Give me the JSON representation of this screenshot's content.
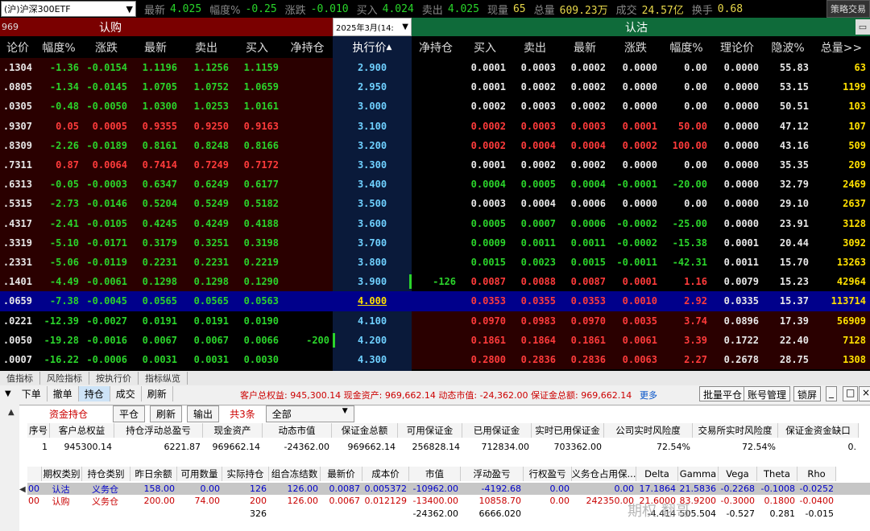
{
  "quote": {
    "symbol": "(沪)沪深300ETF",
    "items": [
      {
        "label": "最新",
        "value": "4.025",
        "cls": "qg"
      },
      {
        "label": "幅度%",
        "value": "-0.25",
        "cls": "qg"
      },
      {
        "label": "涨跌",
        "value": "-0.010",
        "cls": "qg"
      },
      {
        "label": "买入",
        "value": "4.024",
        "cls": "qg"
      },
      {
        "label": "卖出",
        "value": "4.025",
        "cls": "qg"
      },
      {
        "label": "现量",
        "value": "65",
        "cls": "qy"
      },
      {
        "label": "总量",
        "value": "609.23万",
        "cls": "qy"
      },
      {
        "label": "成交",
        "value": "24.57亿",
        "cls": "qy"
      },
      {
        "label": "换手",
        "value": "0.68",
        "cls": "qy"
      }
    ],
    "strategy_button": "策略交易"
  },
  "sections": {
    "call": "认购",
    "put": "认沽",
    "date": "2025年3月(14:",
    "left_code": "969"
  },
  "call_headers": [
    "论价",
    "幅度%",
    "涨跌",
    "最新",
    "卖出",
    "买入",
    "净持仓"
  ],
  "strike_header": "执行价",
  "put_headers": [
    "净持仓",
    "买入",
    "卖出",
    "最新",
    "涨跌",
    "幅度%",
    "理论价",
    "隐波%",
    "总量>>"
  ],
  "rows": [
    {
      "cp": ".1304",
      "cf": "-1.36",
      "cc": "-0.0154",
      "cl": "1.1196",
      "cs": "1.1256",
      "cb": "1.1159",
      "cn": "",
      "k": "2.900",
      "pn": "",
      "pb": "0.0001",
      "ps": "0.0003",
      "pl": "0.0002",
      "pc": "0.0000",
      "pf": "0.00",
      "pt": "0.0000",
      "pv": "55.83",
      "pq": "63"
    },
    {
      "cp": ".0805",
      "cf": "-1.34",
      "cc": "-0.0145",
      "cl": "1.0705",
      "cs": "1.0752",
      "cb": "1.0659",
      "cn": "",
      "k": "2.950",
      "pn": "",
      "pb": "0.0001",
      "ps": "0.0002",
      "pl": "0.0002",
      "pc": "0.0000",
      "pf": "0.00",
      "pt": "0.0000",
      "pv": "53.15",
      "pq": "1199"
    },
    {
      "cp": ".0305",
      "cf": "-0.48",
      "cc": "-0.0050",
      "cl": "1.0300",
      "cs": "1.0253",
      "cb": "1.0161",
      "cn": "",
      "k": "3.000",
      "pn": "",
      "pb": "0.0002",
      "ps": "0.0003",
      "pl": "0.0002",
      "pc": "0.0000",
      "pf": "0.00",
      "pt": "0.0000",
      "pv": "50.51",
      "pq": "103"
    },
    {
      "cp": ".9307",
      "cf": "0.05",
      "cc": "0.0005",
      "cl": "0.9355",
      "cs": "0.9250",
      "cb": "0.9163",
      "cn": "",
      "k": "3.100",
      "pn": "",
      "pb": "0.0002",
      "ps": "0.0003",
      "pl": "0.0003",
      "pc": "0.0001",
      "pf": "50.00",
      "pt": "0.0000",
      "pv": "47.12",
      "pq": "107"
    },
    {
      "cp": ".8309",
      "cf": "-2.26",
      "cc": "-0.0189",
      "cl": "0.8161",
      "cs": "0.8248",
      "cb": "0.8166",
      "cn": "",
      "k": "3.200",
      "pn": "",
      "pb": "0.0002",
      "ps": "0.0004",
      "pl": "0.0004",
      "pc": "0.0002",
      "pf": "100.00",
      "pt": "0.0000",
      "pv": "43.16",
      "pq": "509"
    },
    {
      "cp": ".7311",
      "cf": "0.87",
      "cc": "0.0064",
      "cl": "0.7414",
      "cs": "0.7249",
      "cb": "0.7172",
      "cn": "",
      "k": "3.300",
      "pn": "",
      "pb": "0.0001",
      "ps": "0.0002",
      "pl": "0.0002",
      "pc": "0.0000",
      "pf": "0.00",
      "pt": "0.0000",
      "pv": "35.35",
      "pq": "209"
    },
    {
      "cp": ".6313",
      "cf": "-0.05",
      "cc": "-0.0003",
      "cl": "0.6347",
      "cs": "0.6249",
      "cb": "0.6177",
      "cn": "",
      "k": "3.400",
      "pn": "",
      "pb": "0.0004",
      "ps": "0.0005",
      "pl": "0.0004",
      "pc": "-0.0001",
      "pf": "-20.00",
      "pt": "0.0000",
      "pv": "32.79",
      "pq": "2469"
    },
    {
      "cp": ".5315",
      "cf": "-2.73",
      "cc": "-0.0146",
      "cl": "0.5204",
      "cs": "0.5249",
      "cb": "0.5182",
      "cn": "",
      "k": "3.500",
      "pn": "",
      "pb": "0.0003",
      "ps": "0.0004",
      "pl": "0.0006",
      "pc": "0.0000",
      "pf": "0.00",
      "pt": "0.0000",
      "pv": "29.10",
      "pq": "2637"
    },
    {
      "cp": ".4317",
      "cf": "-2.41",
      "cc": "-0.0105",
      "cl": "0.4245",
      "cs": "0.4249",
      "cb": "0.4188",
      "cn": "",
      "k": "3.600",
      "pn": "",
      "pb": "0.0005",
      "ps": "0.0007",
      "pl": "0.0006",
      "pc": "-0.0002",
      "pf": "-25.00",
      "pt": "0.0000",
      "pv": "23.91",
      "pq": "3128"
    },
    {
      "cp": ".3319",
      "cf": "-5.10",
      "cc": "-0.0171",
      "cl": "0.3179",
      "cs": "0.3251",
      "cb": "0.3198",
      "cn": "",
      "k": "3.700",
      "pn": "",
      "pb": "0.0009",
      "ps": "0.0011",
      "pl": "0.0011",
      "pc": "-0.0002",
      "pf": "-15.38",
      "pt": "0.0001",
      "pv": "20.44",
      "pq": "3092"
    },
    {
      "cp": ".2331",
      "cf": "-5.06",
      "cc": "-0.0119",
      "cl": "0.2231",
      "cs": "0.2231",
      "cb": "0.2219",
      "cn": "",
      "k": "3.800",
      "pn": "",
      "pb": "0.0015",
      "ps": "0.0023",
      "pl": "0.0015",
      "pc": "-0.0011",
      "pf": "-42.31",
      "pt": "0.0011",
      "pv": "15.70",
      "pq": "13263"
    },
    {
      "cp": ".1401",
      "cf": "-4.49",
      "cc": "-0.0061",
      "cl": "0.1298",
      "cs": "0.1298",
      "cb": "0.1290",
      "cn": "",
      "k": "3.900",
      "pn": "-126",
      "pb": "0.0087",
      "ps": "0.0088",
      "pl": "0.0087",
      "pc": "0.0001",
      "pf": "1.16",
      "pt": "0.0079",
      "pv": "15.23",
      "pq": "42964"
    },
    {
      "cp": ".0659",
      "cf": "-7.38",
      "cc": "-0.0045",
      "cl": "0.0565",
      "cs": "0.0565",
      "cb": "0.0563",
      "cn": "",
      "k": "4.000",
      "pn": "",
      "pb": "0.0353",
      "ps": "0.0355",
      "pl": "0.0353",
      "pc": "0.0010",
      "pf": "2.92",
      "pt": "0.0335",
      "pv": "15.37",
      "pq": "113714"
    },
    {
      "cp": ".0221",
      "cf": "-12.39",
      "cc": "-0.0027",
      "cl": "0.0191",
      "cs": "0.0191",
      "cb": "0.0190",
      "cn": "",
      "k": "4.100",
      "pn": "",
      "pb": "0.0970",
      "ps": "0.0983",
      "pl": "0.0970",
      "pc": "0.0035",
      "pf": "3.74",
      "pt": "0.0896",
      "pv": "17.39",
      "pq": "56909"
    },
    {
      "cp": ".0050",
      "cf": "-19.28",
      "cc": "-0.0016",
      "cl": "0.0067",
      "cs": "0.0067",
      "cb": "0.0066",
      "cn": "-200",
      "k": "4.200",
      "pn": "",
      "pb": "0.1861",
      "ps": "0.1864",
      "pl": "0.1861",
      "pc": "0.0061",
      "pf": "3.39",
      "pt": "0.1722",
      "pv": "22.40",
      "pq": "7128"
    },
    {
      "cp": ".0007",
      "cf": "-16.22",
      "cc": "-0.0006",
      "cl": "0.0031",
      "cs": "0.0031",
      "cb": "0.0030",
      "cn": "",
      "k": "4.300",
      "pn": "",
      "pb": "0.2800",
      "ps": "0.2836",
      "pl": "0.2836",
      "pc": "0.0063",
      "pf": "2.27",
      "pt": "0.2678",
      "pv": "28.75",
      "pq": "1308"
    }
  ],
  "tabs1": [
    "值指标",
    "风险指标",
    "按执行价",
    "指标纵览"
  ],
  "bottom": {
    "buttons": [
      "下单",
      "撤单",
      "持仓",
      "成交",
      "刷新"
    ],
    "summary": "客户总权益: 945,300.14  现金资产: 969,662.14  动态市值: -24,362.00  保证金总额: 969,662.14",
    "more": "更多",
    "right_buttons": [
      "批量平仓",
      "账号管理",
      "锁屏"
    ],
    "panel_tabs": [
      "资金持仓",
      "平仓",
      "刷新",
      "输出",
      "共3条",
      "全部"
    ],
    "acct_headers": [
      "序号",
      "客户总权益",
      "持仓浮动总盈亏",
      "现金资产",
      "动态市值",
      "保证金总额",
      "可用保证金",
      "已用保证金",
      "实时已用保证金",
      "公司实时风险度",
      "交易所实时风险度",
      "保证金资金缺口"
    ],
    "acct_row": [
      "1",
      "945300.14",
      "6221.87",
      "969662.14",
      "-24362.00",
      "969662.14",
      "256828.14",
      "712834.00",
      "703362.00",
      "72.54%",
      "72.54%",
      "0."
    ],
    "pos_headers": [
      "期权类别",
      "持仓类别",
      "昨日余额",
      "可用数量",
      "实际持仓",
      "组合冻结数",
      "最新价",
      "成本价",
      "市值",
      "浮动盈亏",
      "行权盈亏",
      "义务仓占用保...",
      "Delta",
      "Gamma",
      "Vega",
      "Theta",
      "Rho"
    ],
    "pos_rows": [
      [
        "00",
        "认沽",
        "义务仓",
        "158.00",
        "0.00",
        "126",
        "126.00",
        "0.0087",
        "0.005372",
        "-10962.00",
        "-4192.68",
        "0.00",
        "0.00",
        "17.1864",
        "21.5836",
        "-0.2268",
        "-0.1008",
        "-0.0252"
      ],
      [
        "00",
        "认购",
        "义务仓",
        "200.00",
        "74.00",
        "200",
        "126.00",
        "0.0067",
        "0.012129",
        "-13400.00",
        "10858.70",
        "0.00",
        "242350.00",
        "21.6000",
        "83.9200",
        "-0.3000",
        "0.1800",
        "-0.0400"
      ]
    ],
    "total_row": [
      "326",
      "-24362.00",
      "6666.020",
      "-4.414",
      "505.504",
      "-0.527",
      "0.281",
      "-0.015"
    ],
    "watermark": "期权 翻哥"
  },
  "colors": {
    "call_bg": "#7a0000",
    "put_bg": "#0f6b3a",
    "highlight": "#00008b"
  }
}
